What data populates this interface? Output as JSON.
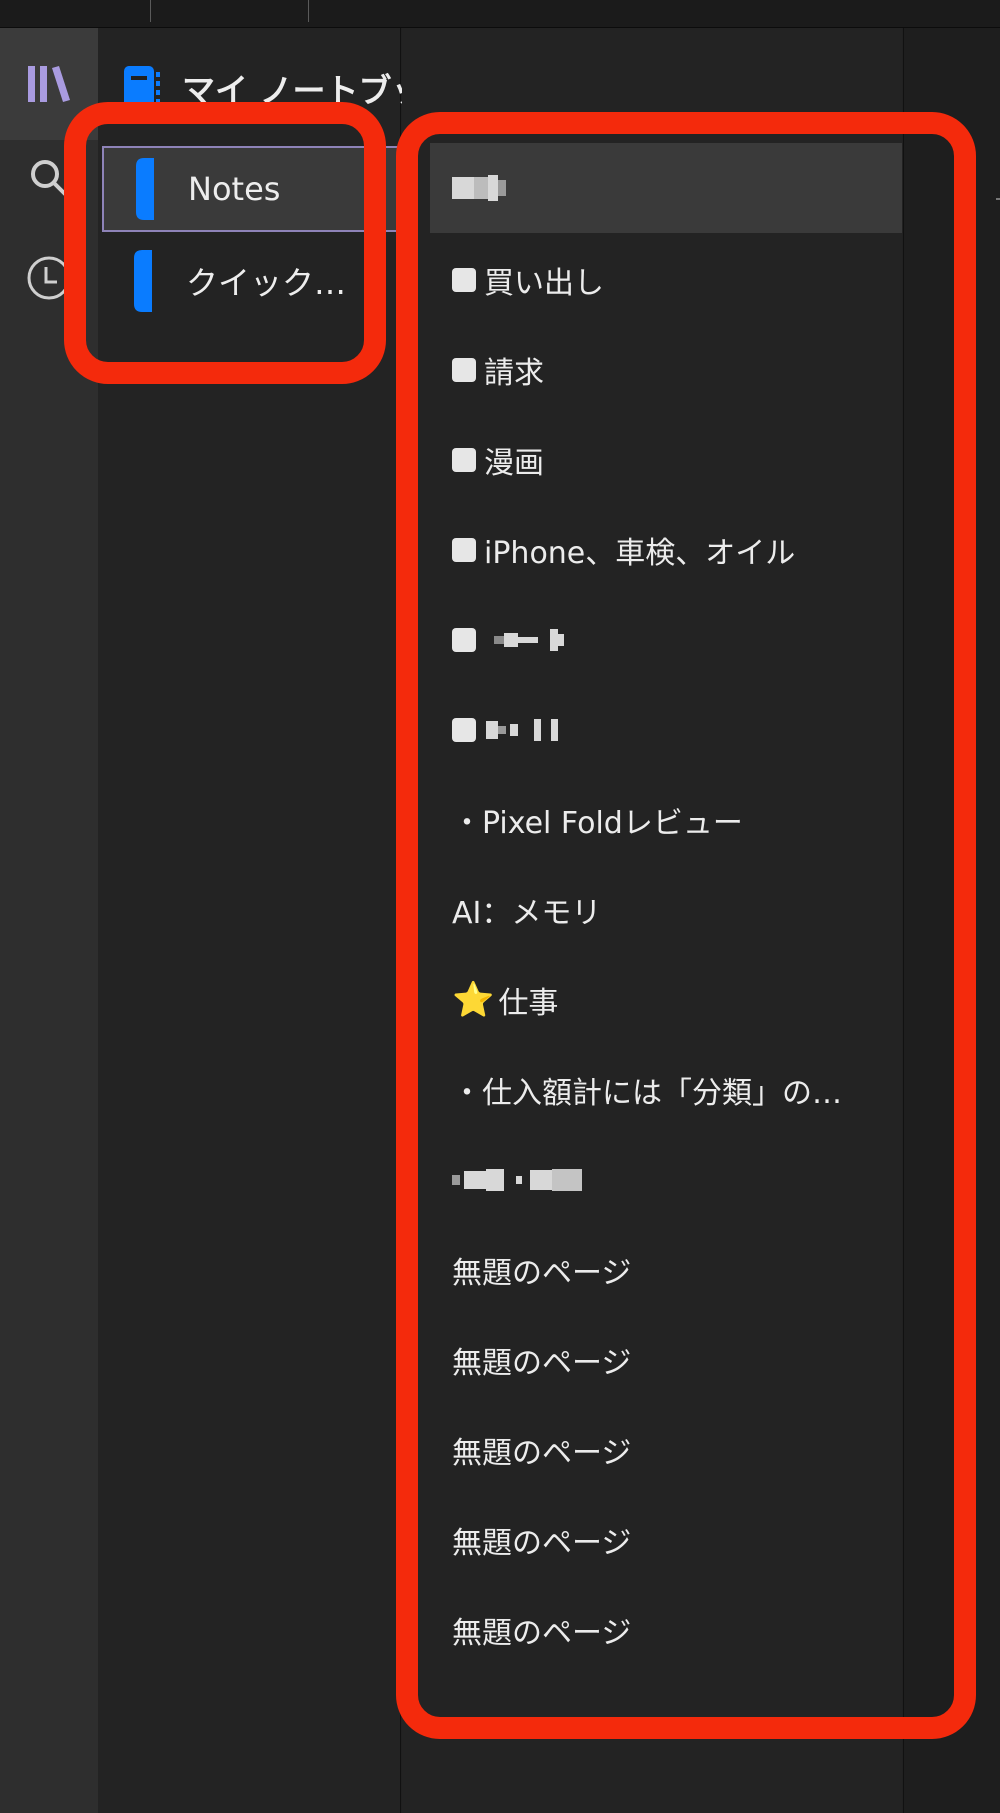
{
  "app": {
    "notebook_title": "マイ ノートブック",
    "accent": "#0a7cff",
    "rail_accent": "#a99be0",
    "annotation_color": "#f42a0c"
  },
  "rail": {
    "items": [
      {
        "icon": "library-icon",
        "active": true
      },
      {
        "icon": "search-icon",
        "active": false
      },
      {
        "icon": "recent-clock-icon",
        "active": false
      }
    ]
  },
  "sections": [
    {
      "label": "Notes",
      "selected": true
    },
    {
      "label": "クイック…",
      "selected": false
    }
  ],
  "pages": [
    {
      "label": "",
      "selected": true,
      "redacted": true,
      "checkbox": false
    },
    {
      "label": "買い出し",
      "checkbox": true
    },
    {
      "label": "請求",
      "checkbox": true
    },
    {
      "label": "漫画",
      "checkbox": true
    },
    {
      "label": "iPhone、車検、オイル",
      "checkbox": true
    },
    {
      "label": "",
      "checkbox": true,
      "redacted": true
    },
    {
      "label": "",
      "checkbox": true,
      "redacted": true
    },
    {
      "label": "・Pixel Foldレビュー"
    },
    {
      "label": "AI：メモリ"
    },
    {
      "label": "仕事",
      "emoji": "⭐"
    },
    {
      "label": "・仕入額計には「分類」の…"
    },
    {
      "label": "",
      "redacted": true
    },
    {
      "label": "無題のページ"
    },
    {
      "label": "無題のページ"
    },
    {
      "label": "無題のページ"
    },
    {
      "label": "無題のページ"
    },
    {
      "label": "無題のページ"
    }
  ]
}
